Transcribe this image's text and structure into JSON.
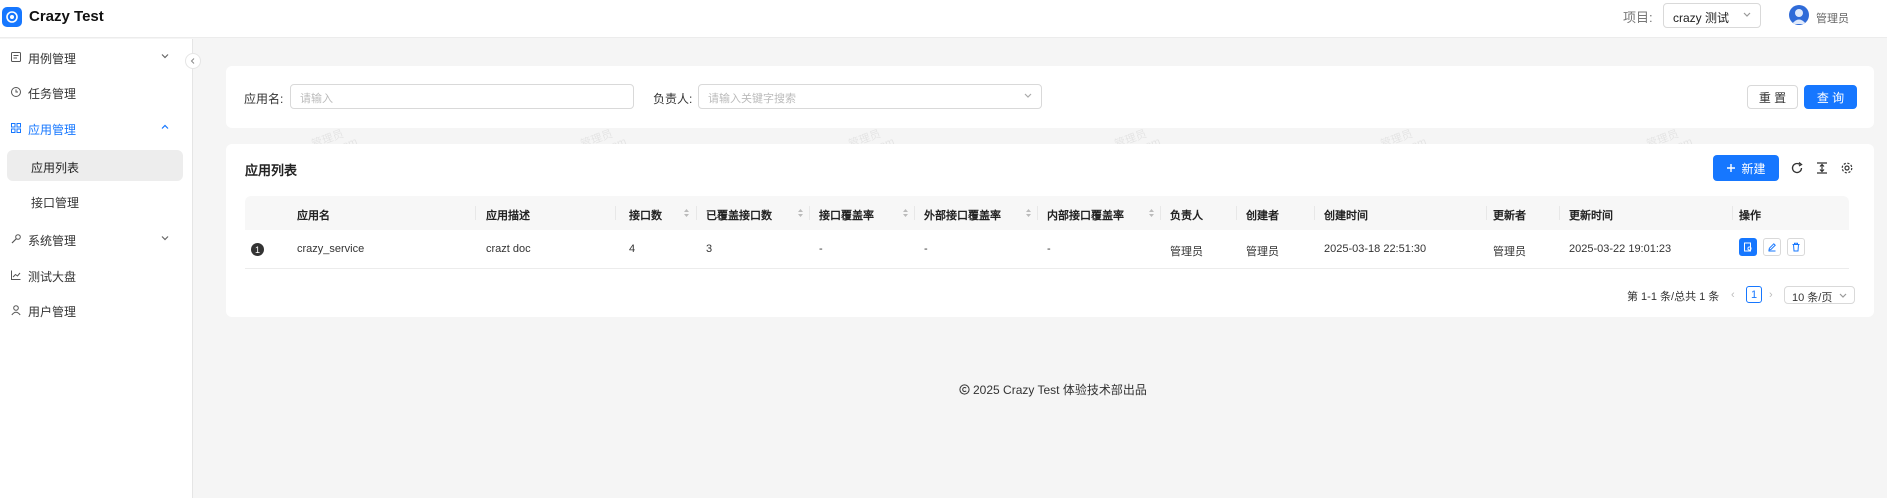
{
  "header": {
    "app_title": "Crazy Test",
    "project_label": "项目:",
    "project_value": "crazy 测试",
    "user_name": "管理员"
  },
  "sidebar": {
    "items": [
      {
        "label": "用例管理"
      },
      {
        "label": "任务管理"
      },
      {
        "label": "应用管理"
      },
      {
        "label": "系统管理"
      },
      {
        "label": "测试大盘"
      },
      {
        "label": "用户管理"
      }
    ],
    "sub_items": [
      {
        "label": "应用列表"
      },
      {
        "label": "接口管理"
      }
    ]
  },
  "filter": {
    "app_name_label": "应用名:",
    "app_name_placeholder": "请输入",
    "owner_label": "负责人:",
    "owner_placeholder": "请输入关键字搜索",
    "reset_label": "重 置",
    "query_label": "查 询"
  },
  "table": {
    "title": "应用列表",
    "new_label": "新建",
    "columns": [
      "应用名",
      "应用描述",
      "接口数",
      "已覆盖接口数",
      "接口覆盖率",
      "外部接口覆盖率",
      "内部接口覆盖率",
      "负责人",
      "创建者",
      "创建时间",
      "更新者",
      "更新时间",
      "操作"
    ],
    "rows": [
      {
        "index": "1",
        "app_name": "crazy_service",
        "description": "crazt doc",
        "api_count": "4",
        "covered_count": "3",
        "coverage": "-",
        "external_coverage": "-",
        "internal_coverage": "-",
        "owner": "管理员",
        "creator": "管理员",
        "created_at": "2025-03-18 22:51:30",
        "updater": "管理员",
        "updated_at": "2025-03-22 19:01:23"
      }
    ]
  },
  "pagination": {
    "total_text": "第 1-1 条/总共 1 条",
    "current_page": "1",
    "page_size": "10 条/页"
  },
  "watermark": {
    "line1": "管理员",
    "line2": "118qq.com"
  },
  "footer": {
    "text": "2025 Crazy Test 体验技术部出品"
  },
  "colors": {
    "primary": "#1677ff",
    "page_bg": "#f5f5f5"
  }
}
